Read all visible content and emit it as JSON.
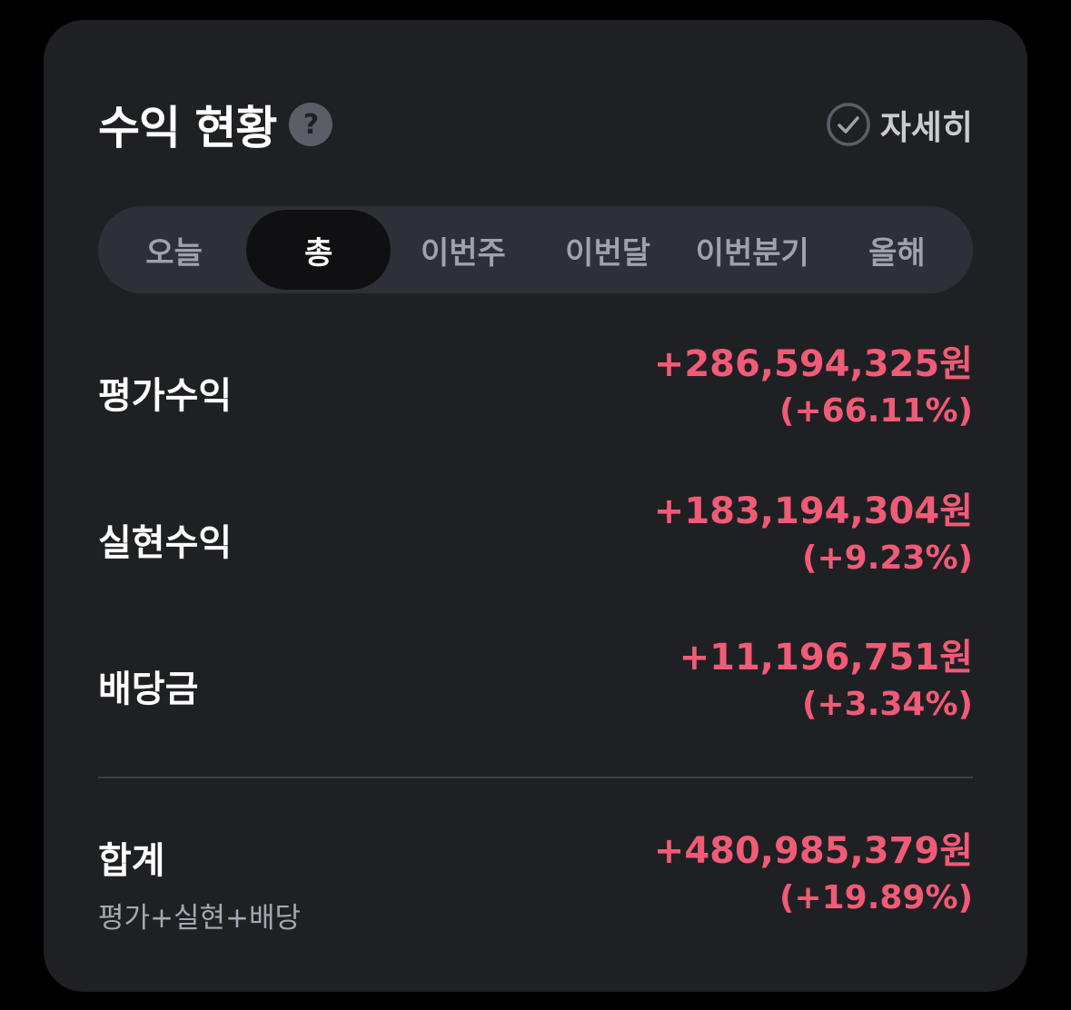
{
  "header": {
    "title": "수익 현황",
    "help_icon": "?",
    "detail_label": "자세히"
  },
  "tabs": [
    {
      "label": "오늘",
      "active": false
    },
    {
      "label": "총",
      "active": true
    },
    {
      "label": "이번주",
      "active": false
    },
    {
      "label": "이번달",
      "active": false
    },
    {
      "label": "이번분기",
      "active": false
    },
    {
      "label": "올해",
      "active": false
    }
  ],
  "rows": [
    {
      "label": "평가수익",
      "amount": "+286,594,325원",
      "percent": "(+66.11%)"
    },
    {
      "label": "실현수익",
      "amount": "+183,194,304원",
      "percent": "(+9.23%)"
    },
    {
      "label": "배당금",
      "amount": "+11,196,751원",
      "percent": "(+3.34%)"
    }
  ],
  "total": {
    "label": "합계",
    "sub_label": "평가+실현+배당",
    "amount": "+480,985,379원",
    "percent": "(+19.89%)"
  },
  "colors": {
    "positive": "#f15b75",
    "card": "#1f2024",
    "tab_track": "#2e3037",
    "tab_active": "#101012"
  }
}
